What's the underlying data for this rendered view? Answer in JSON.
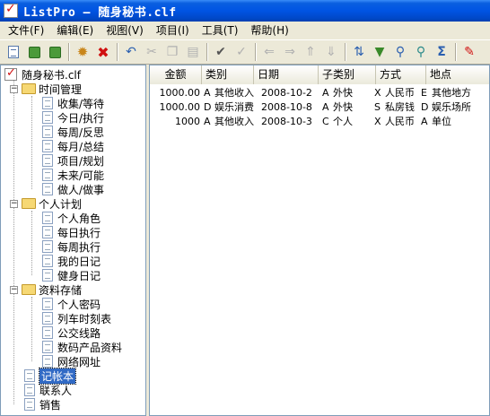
{
  "window": {
    "title": "ListPro – 随身秘书.clf"
  },
  "menu": [
    {
      "label": "文件(F)"
    },
    {
      "label": "编辑(E)"
    },
    {
      "label": "视图(V)"
    },
    {
      "label": "项目(I)"
    },
    {
      "label": "工具(T)"
    },
    {
      "label": "帮助(H)"
    }
  ],
  "toolbar": {
    "buttons": [
      "new-item",
      "add-child",
      "add-sibling",
      "settings",
      "delete",
      "undo",
      "cut",
      "copy",
      "paste",
      "check",
      "uncheck",
      "move-left",
      "move-right",
      "move-up",
      "move-down",
      "sort",
      "filter",
      "find",
      "find-next",
      "sum",
      "edit"
    ]
  },
  "tree": {
    "root": "随身秘书.clf",
    "groups": [
      {
        "label": "时间管理",
        "items": [
          "收集/等待",
          "今日/执行",
          "每周/反思",
          "每月/总结",
          "项目/规划",
          "未来/可能",
          "做人/做事"
        ]
      },
      {
        "label": "个人计划",
        "items": [
          "个人角色",
          "每日执行",
          "每周执行",
          "我的日记",
          "健身日记"
        ]
      },
      {
        "label": "资料存储",
        "items": [
          "个人密码",
          "列车时刻表",
          "公交线路",
          "数码产品资料",
          "网络网址"
        ]
      }
    ],
    "leaves": [
      "记帐本",
      "联系人",
      "销售"
    ],
    "selected": "记帐本"
  },
  "list": {
    "columns": [
      "金额",
      "类别",
      "日期",
      "子类别",
      "方式",
      "地点"
    ],
    "rows": [
      {
        "amount": "1000.00",
        "cat_code": "A",
        "category": "其他收入",
        "date": "2008-10-2",
        "sub_code": "A",
        "subcategory": "外快",
        "method_code": "X",
        "method": "人民币",
        "place_code": "E",
        "place": "其他地方"
      },
      {
        "amount": "1000.00",
        "cat_code": "D",
        "category": "娱乐消费",
        "date": "2008-10-8",
        "sub_code": "A",
        "subcategory": "外快",
        "method_code": "S",
        "method": "私房钱",
        "place_code": "D",
        "place": "娱乐场所"
      },
      {
        "amount": "1000",
        "cat_code": "A",
        "category": "其他收入",
        "date": "2008-10-3",
        "sub_code": "C",
        "subcategory": "个人",
        "method_code": "X",
        "method": "人民币",
        "place_code": "A",
        "place": "单位"
      }
    ]
  }
}
